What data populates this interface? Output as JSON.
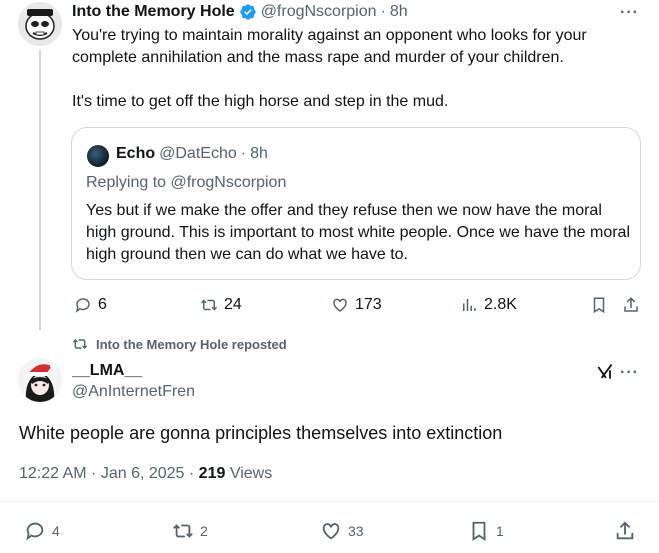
{
  "tweet": {
    "author_name": "Into the Memory Hole",
    "author_handle": "@frogNscorpion",
    "time": "8h",
    "more": "···",
    "text_p1": "You're trying to maintain morality against an opponent who looks for your complete annihilation and the mass rape and murder of your children.",
    "text_p2": "It's time to get off the high horse and step in the mud.",
    "quote": {
      "author_name": "Echo",
      "author_handle": "@DatEcho",
      "time": "8h",
      "replying_to": "Replying to @frogNscorpion",
      "text": "Yes but if we make the offer and they refuse then we now have the moral high ground. This is important to most white people. Once we have the moral high ground then we can do what we have to."
    },
    "actions": {
      "replies": "6",
      "reposts": "24",
      "likes": "173",
      "views": "2.8K"
    }
  },
  "repost_banner": "Into the Memory Hole reposted",
  "main_tweet": {
    "author_name": "__LMA__",
    "author_handle": "@AnInternetFren",
    "more": "···",
    "text": "White people are gonna principles themselves into extinction",
    "timestamp": "12:22 AM · Jan 6, 2025 · ",
    "views_count": "219",
    "views_label": " Views",
    "actions": {
      "replies": "4",
      "reposts": "2",
      "likes": "33",
      "bookmarks": "1"
    }
  },
  "colors": {
    "accent": "#1d9bf0",
    "secondary_text": "#536471",
    "border": "#cfd9de"
  },
  "icons": [
    "verified-badge-icon",
    "reply-icon",
    "repost-icon",
    "like-icon",
    "views-icon",
    "bookmark-icon",
    "share-icon",
    "grok-icon",
    "more-icon"
  ]
}
